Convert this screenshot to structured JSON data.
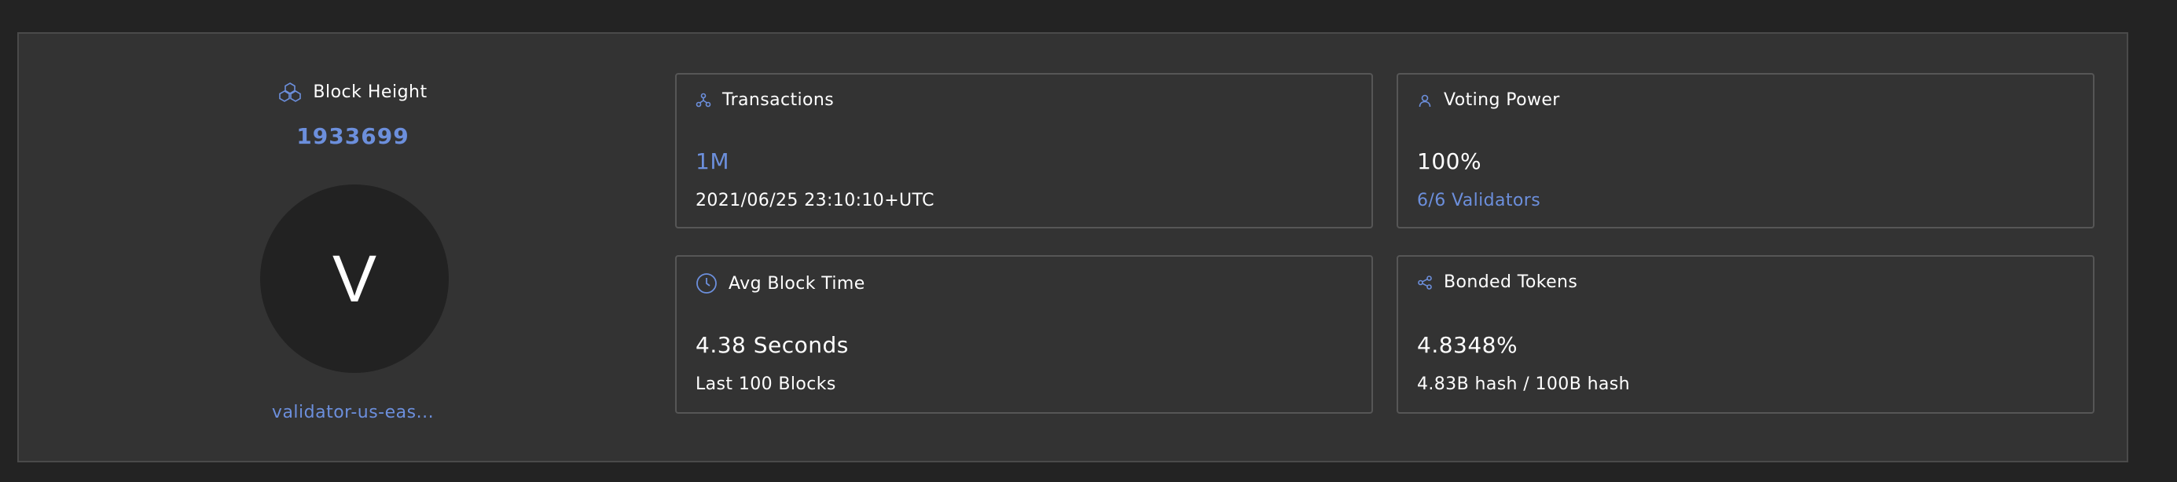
{
  "block_height": {
    "title": "Block Height",
    "icon": "blocks-icon",
    "value": "1933699",
    "avatar_letter": "V",
    "validator_name": "validator-us-eas..."
  },
  "cards": {
    "transactions": {
      "title": "Transactions",
      "icon": "network-icon",
      "value": "1M",
      "sub": "2021/06/25 23:10:10+UTC"
    },
    "voting_power": {
      "title": "Voting Power",
      "icon": "user-icon",
      "value": "100%",
      "sub": "6/6 Validators"
    },
    "avg_block_time": {
      "title": "Avg Block Time",
      "icon": "clock-icon",
      "value": "4.38 Seconds",
      "sub": "Last 100 Blocks"
    },
    "bonded_tokens": {
      "title": "Bonded Tokens",
      "icon": "share-icon",
      "value": "4.8348%",
      "sub": "4.83B hash / 100B hash"
    }
  },
  "colors": {
    "page_bg": "#232323",
    "panel_bg": "#333333",
    "accent": "#6c8fdc",
    "avatar_bg": "#222222"
  }
}
